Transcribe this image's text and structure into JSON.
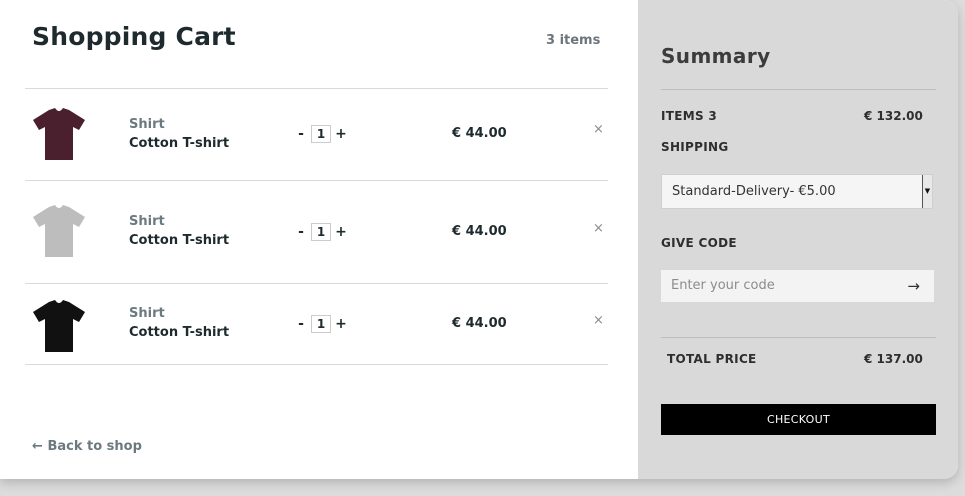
{
  "cart": {
    "title": "Shopping Cart",
    "items_count": "3 items",
    "items": [
      {
        "category": "Shirt",
        "name": "Cotton T-shirt",
        "qty": "1",
        "price": "€ 44.00",
        "color": "#4a1f2e",
        "minus": "-",
        "plus": "+",
        "remove": "×"
      },
      {
        "category": "Shirt",
        "name": "Cotton T-shirt",
        "qty": "1",
        "price": "€ 44.00",
        "color": "#bdbdbd",
        "minus": "-",
        "plus": "+",
        "remove": "×"
      },
      {
        "category": "Shirt",
        "name": "Cotton T-shirt",
        "qty": "1",
        "price": "€ 44.00",
        "color": "#111111",
        "minus": "-",
        "plus": "+",
        "remove": "×"
      }
    ],
    "back_arrow": "←",
    "back_label": "Back to shop"
  },
  "summary": {
    "title": "Summary",
    "items_label": "ITEMS 3",
    "items_total": "€ 132.00",
    "shipping_label": "SHIPPING",
    "shipping_selected": "Standard-Delivery- €5.00",
    "give_code_label": "GIVE CODE",
    "code_placeholder": "Enter your code",
    "code_submit": "→",
    "total_label": "TOTAL PRICE",
    "total_value": "€ 137.00",
    "checkout_label": "CHECKOUT"
  },
  "icons": {
    "product": "t-shirt-icon",
    "remove": "close-icon",
    "back": "arrow-left-icon",
    "submit": "arrow-right-icon",
    "dropdown": "caret-down-icon"
  }
}
